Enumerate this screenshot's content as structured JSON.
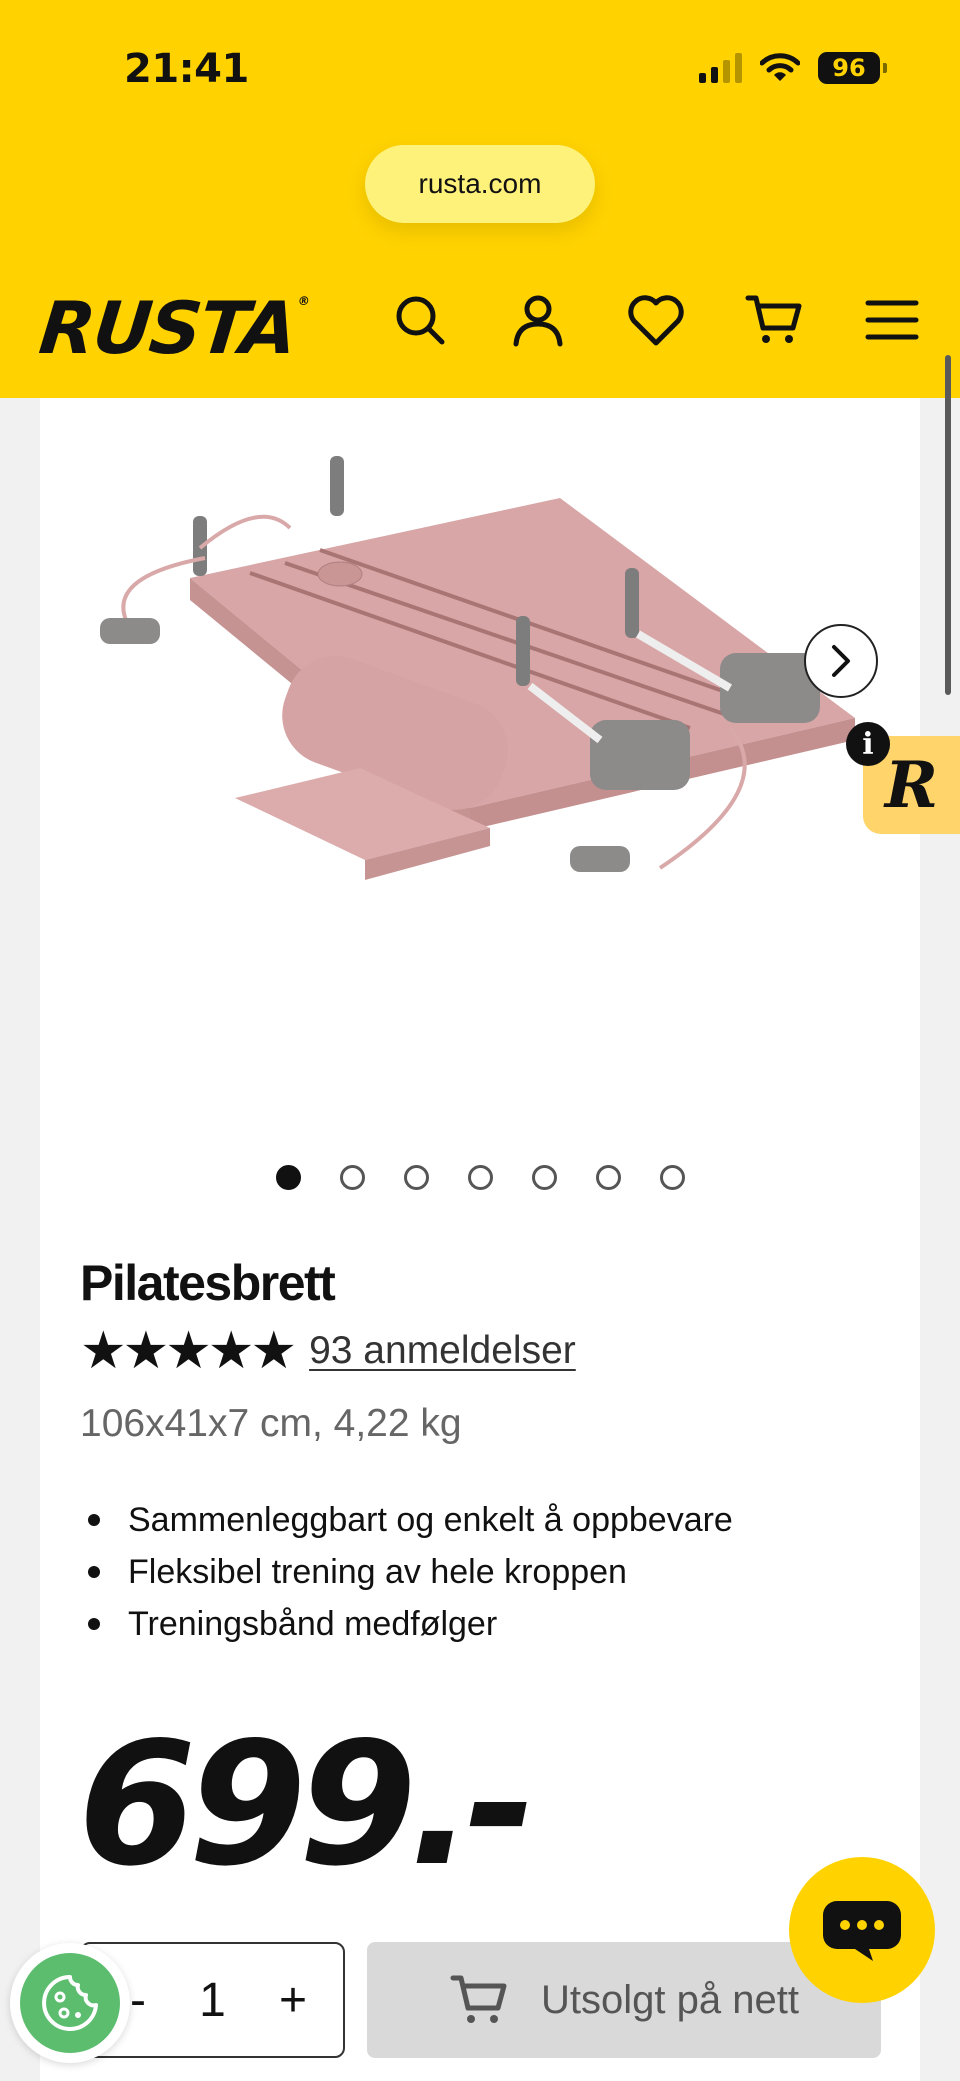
{
  "status_bar": {
    "time": "21:41",
    "battery": "96"
  },
  "browser": {
    "url": "rusta.com"
  },
  "header": {
    "logo": "RUSTA",
    "icons": [
      "search-icon",
      "account-icon",
      "heart-icon",
      "cart-icon",
      "menu-icon"
    ]
  },
  "gallery": {
    "image_count": 7,
    "active_index": 0
  },
  "badge": {
    "letter": "R",
    "info": "i"
  },
  "product": {
    "title": "Pilatesbrett",
    "stars": "★★★★★",
    "rating": 5,
    "reviews": "93 anmeldelser",
    "dimensions": "106x41x7 cm, 4,22 kg",
    "bullets": [
      "Sammenleggbart og enkelt å oppbevare",
      "Fleksibel trening av hele kroppen",
      "Treningsbånd medfølger"
    ],
    "price": "699.-"
  },
  "purchase": {
    "minus": "-",
    "quantity": "1",
    "plus": "+",
    "button_label": "Utsolgt på nett"
  },
  "colors": {
    "brand_yellow": "#ffd200",
    "product_pink": "#d9a9a9",
    "cookie_green": "#5cbd6e"
  }
}
